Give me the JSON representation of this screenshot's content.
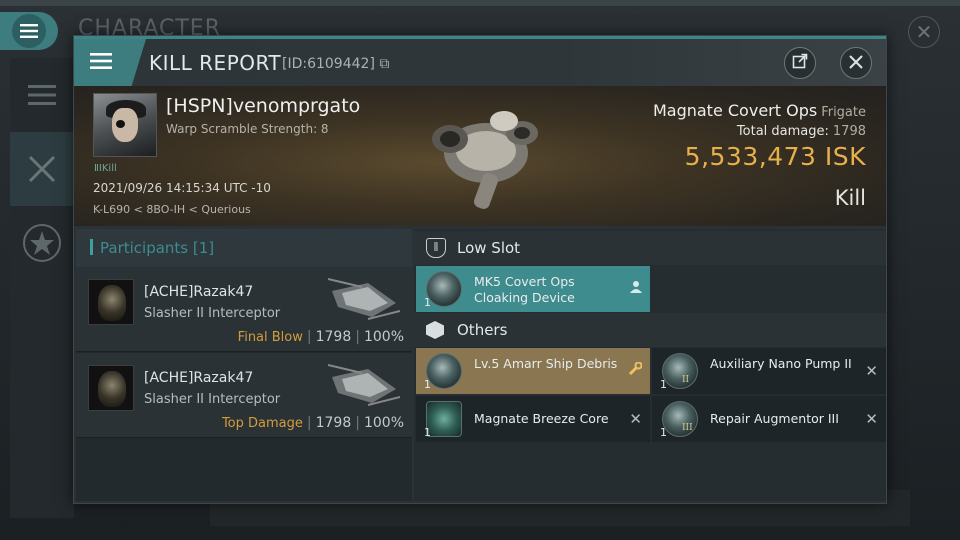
{
  "background": {
    "title": "CHARACTER",
    "close_label": "✕"
  },
  "header": {
    "title": "KILL REPORT",
    "id_text": "[ID:6109442]",
    "share_icon": "external-link-icon",
    "close_icon": "close-icon"
  },
  "victim": {
    "name": "[HSPN]venomprgato",
    "warp_scramble": "Warp Scramble Strength: 8",
    "tag": "Kill",
    "date": "2021/09/26 14:15:34 UTC -10",
    "location": "K-L690 < 8BO-IH < Querious",
    "ship_name": "Magnate Covert Ops",
    "ship_class": "Frigate",
    "total_damage_label": "Total damage:",
    "total_damage": "1798",
    "isk_value": "5,533,473",
    "isk_unit": "ISK",
    "result": "Kill"
  },
  "participants": {
    "header": "Participants [1]",
    "rows": [
      {
        "name": "[ACHE]Razak47",
        "ship": "Slasher II Interceptor",
        "tag": "Final Blow",
        "damage": "1798",
        "percent": "100%"
      },
      {
        "name": "[ACHE]Razak47",
        "ship": "Slasher II Interceptor",
        "tag": "Top Damage",
        "damage": "1798",
        "percent": "100%"
      }
    ]
  },
  "items": {
    "low_slot": {
      "title": "Low Slot",
      "entries": [
        {
          "qty": "1",
          "name": "MK5 Covert Ops Cloaking Device",
          "action_icon": "person-icon"
        }
      ]
    },
    "others": {
      "title": "Others",
      "entries": [
        {
          "qty": "1",
          "name": "Lv.5 Amarr Ship Debris",
          "action_icon": "wrench-icon"
        },
        {
          "qty": "1",
          "name": "Auxiliary Nano Pump II",
          "tier": "II",
          "action_icon": "close-icon"
        },
        {
          "qty": "1",
          "name": "Magnate Breeze Core",
          "action_icon": "close-icon"
        },
        {
          "qty": "1",
          "name": "Repair Augmentor III",
          "tier": "III",
          "action_icon": "close-icon"
        }
      ]
    }
  },
  "colors": {
    "accent_teal": "#3d7d7f",
    "isk_gold": "#e8b04a",
    "final_blow_orange": "#d39c3b"
  }
}
